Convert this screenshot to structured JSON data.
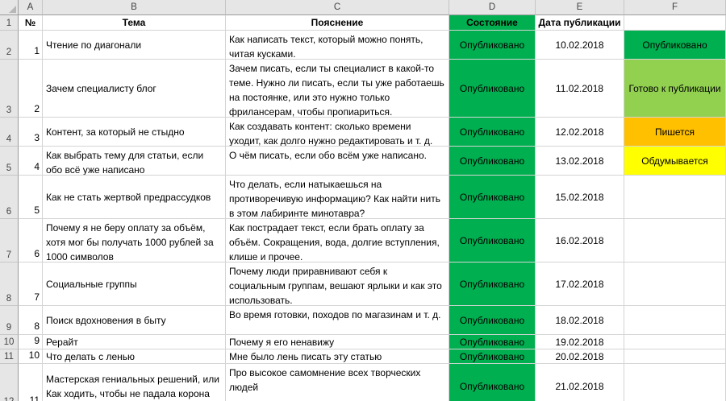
{
  "columns": [
    "A",
    "B",
    "C",
    "D",
    "E",
    "F"
  ],
  "header_row": {
    "num": "1",
    "a": "№",
    "b": "Тема",
    "c": "Пояснение",
    "d": "Состояние",
    "e": "Дата публикации",
    "f": ""
  },
  "rows": [
    {
      "row": "2",
      "num": "1",
      "topic": "Чтение по диагонали",
      "desc": "Как написать текст, который можно понять, читая кусками.",
      "status": "Опубликовано",
      "date": "10.02.2018",
      "legend": "Опубликовано"
    },
    {
      "row": "3",
      "num": "2",
      "topic": "Зачем специалисту блог",
      "desc": "Зачем писать, если ты специалист в какой-то теме. Нужно ли писать, если ты уже работаешь на постоянке, или это нужно только фрилансерам, чтобы пропиариться.",
      "status": "Опубликовано",
      "date": "11.02.2018",
      "legend": "Готово к публикации"
    },
    {
      "row": "4",
      "num": "3",
      "topic": "Контент, за который не стыдно",
      "desc": "Как создавать контент: сколько времени уходит, как долго нужно редактировать и т. д.",
      "status": "Опубликовано",
      "date": "12.02.2018",
      "legend": "Пишется"
    },
    {
      "row": "5",
      "num": "4",
      "topic": "Как выбрать тему для статьи, если обо всё уже написано",
      "desc": "О чём писать, если обо всём уже написано.",
      "status": "Опубликовано",
      "date": "13.02.2018",
      "legend": "Обдумывается"
    },
    {
      "row": "6",
      "num": "5",
      "topic": "Как не стать жертвой предрассудков",
      "desc": "Что делать, если натыкаешься на противоречивую информацию? Как найти нить в этом лабиринте минотавра?",
      "status": "Опубликовано",
      "date": "15.02.2018",
      "legend": ""
    },
    {
      "row": "7",
      "num": "6",
      "topic": "Почему я не беру оплату за объём, хотя мог бы получать 1000 рублей за 1000 символов",
      "desc": "Как пострадает текст, если брать оплату за объём. Сокращения, вода, долгие вступления, клише и прочее.",
      "status": "Опубликовано",
      "date": "16.02.2018",
      "legend": ""
    },
    {
      "row": "8",
      "num": "7",
      "topic": "Социальные группы",
      "desc": "Почему люди приравнивают себя к социальным группам, вешают ярлыки и как это использовать.",
      "status": "Опубликовано",
      "date": "17.02.2018",
      "legend": ""
    },
    {
      "row": "9",
      "num": "8",
      "topic": "Поиск вдохновения в быту",
      "desc": "Во время готовки, походов по магазинам и т. д.",
      "status": "Опубликовано",
      "date": "18.02.2018",
      "legend": ""
    },
    {
      "row": "10",
      "num": "9",
      "topic": "Рерайт",
      "desc": "Почему я его ненавижу",
      "status": "Опубликовано",
      "date": "19.02.2018",
      "legend": ""
    },
    {
      "row": "11",
      "num": "10",
      "topic": "Что делать с ленью",
      "desc": "Мне было лень писать эту статью",
      "status": "Опубликовано",
      "date": "20.02.2018",
      "legend": ""
    },
    {
      "row": "12",
      "num": "11",
      "topic": "Мастерская гениальных решений, или Как ходить, чтобы не падала корона",
      "desc": "Про высокое самомнение всех творческих людей",
      "status": "Опубликовано",
      "date": "21.02.2018",
      "legend": ""
    }
  ],
  "colors": {
    "published": "#00b050",
    "ready": "#92d050",
    "writing": "#ffc000",
    "thinking": "#ffff00"
  }
}
